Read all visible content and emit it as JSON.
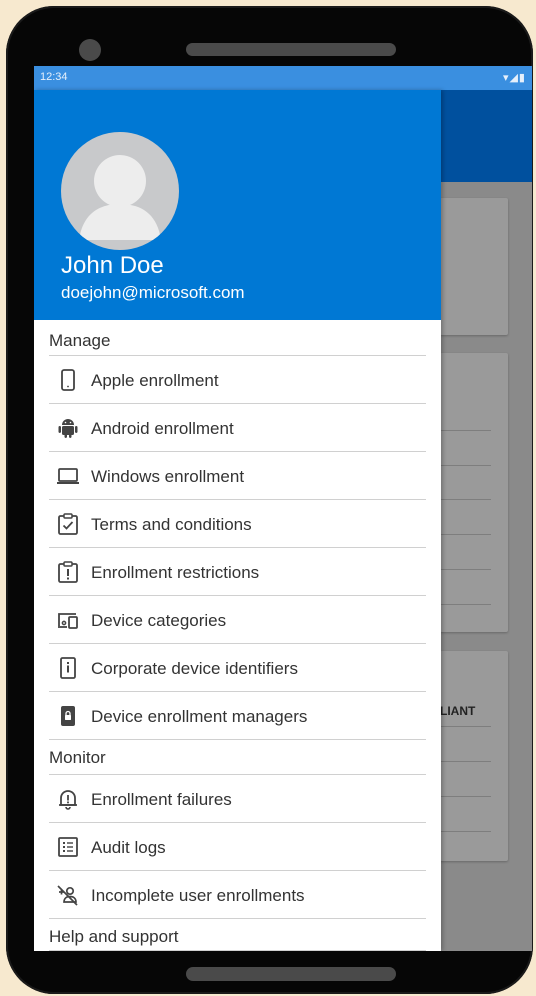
{
  "status_bar": {
    "time": "12:34",
    "icons": "▾◢▮"
  },
  "profile": {
    "name": "John Doe",
    "email": "doejohn@microsoft.com"
  },
  "background": {
    "partial_text": "LIANT"
  },
  "menu": {
    "manage": {
      "header": "Manage",
      "items": [
        {
          "label": "Apple enrollment",
          "icon": "phone-icon"
        },
        {
          "label": "Android enrollment",
          "icon": "android-icon"
        },
        {
          "label": "Windows enrollment",
          "icon": "laptop-icon"
        },
        {
          "label": "Terms and conditions",
          "icon": "clipboard-check-icon"
        },
        {
          "label": "Enrollment restrictions",
          "icon": "clipboard-alert-icon"
        },
        {
          "label": "Device categories",
          "icon": "devices-icon"
        },
        {
          "label": "Corporate device identifiers",
          "icon": "device-info-icon"
        },
        {
          "label": "Device enrollment managers",
          "icon": "device-lock-icon"
        }
      ]
    },
    "monitor": {
      "header": "Monitor",
      "items": [
        {
          "label": "Enrollment failures",
          "icon": "bell-alert-icon"
        },
        {
          "label": "Audit logs",
          "icon": "list-icon"
        },
        {
          "label": "Incomplete user enrollments",
          "icon": "user-off-icon"
        }
      ]
    },
    "help": {
      "header": "Help and support"
    }
  },
  "colors": {
    "drawer_header": "#0078d4",
    "app_bar": "#00509e",
    "status_bar": "#3a8fe0",
    "icon": "#444444"
  }
}
